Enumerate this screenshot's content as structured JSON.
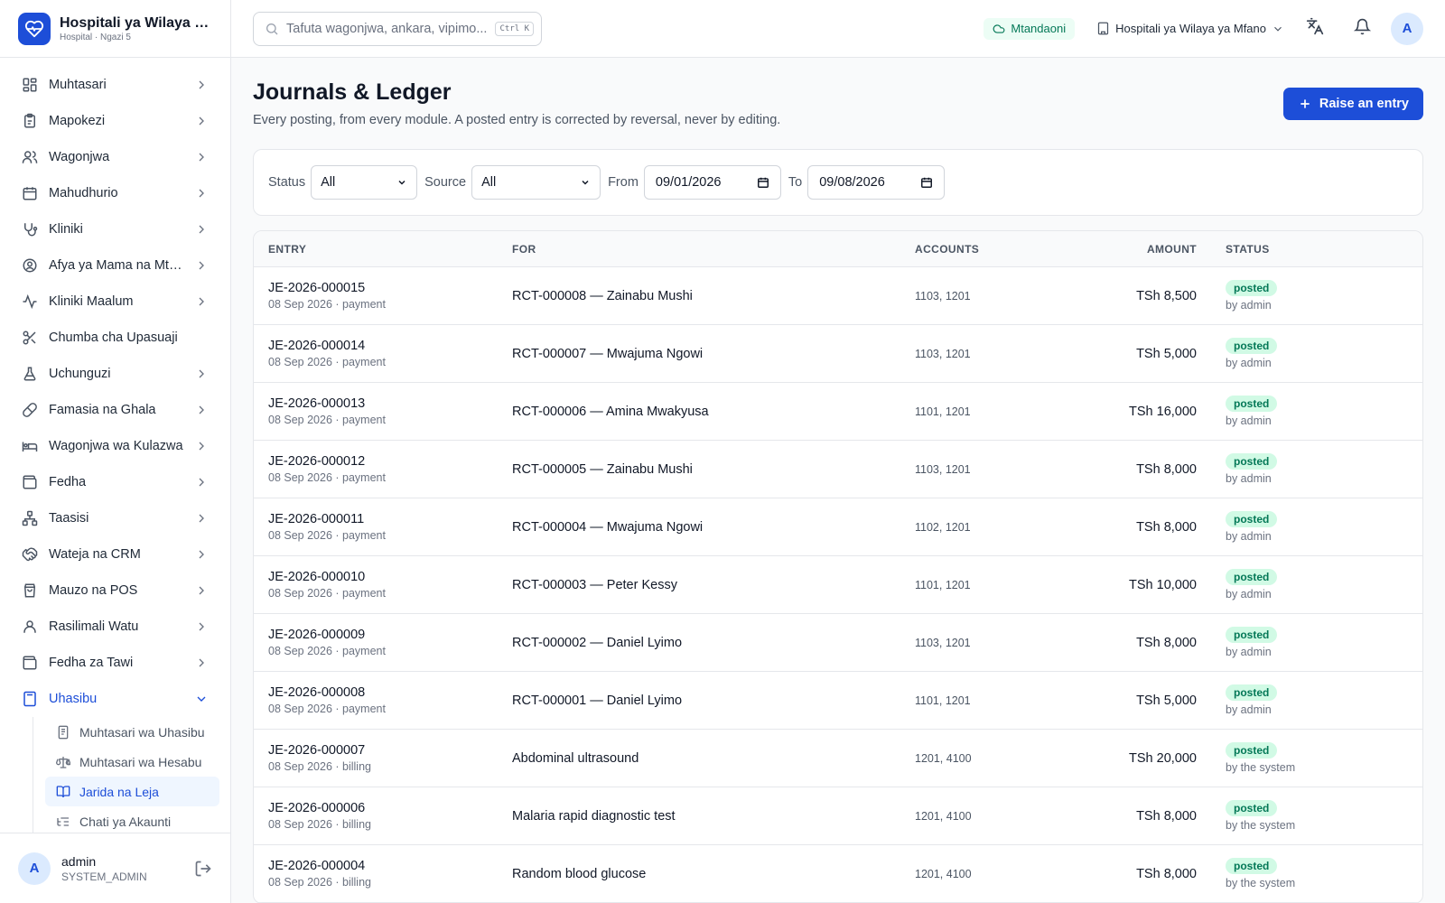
{
  "brand": {
    "title": "Hospitali ya Wilaya ya Mfano",
    "subtitle": "Hospital · Ngazi 5"
  },
  "sidebar": {
    "items": [
      {
        "label": "Muhtasari",
        "icon": "grid-icon"
      },
      {
        "label": "Mapokezi",
        "icon": "clipboard-icon"
      },
      {
        "label": "Wagonjwa",
        "icon": "users-icon"
      },
      {
        "label": "Mahudhurio",
        "icon": "calendar-icon"
      },
      {
        "label": "Kliniki",
        "icon": "stethoscope-icon"
      },
      {
        "label": "Afya ya Mama na Mtoto",
        "icon": "mother-child-icon"
      },
      {
        "label": "Kliniki Maalum",
        "icon": "activity-icon"
      },
      {
        "label": "Chumba cha Upasuaji",
        "icon": "scissors-icon"
      },
      {
        "label": "Uchunguzi",
        "icon": "flask-icon"
      },
      {
        "label": "Famasia na Ghala",
        "icon": "pill-icon"
      },
      {
        "label": "Wagonjwa wa Kulazwa",
        "icon": "bed-icon"
      },
      {
        "label": "Fedha",
        "icon": "wallet-icon"
      },
      {
        "label": "Taasisi",
        "icon": "org-icon"
      },
      {
        "label": "Wateja na CRM",
        "icon": "handshake-icon"
      },
      {
        "label": "Mauzo na POS",
        "icon": "bag-icon"
      },
      {
        "label": "Rasilimali Watu",
        "icon": "user-icon"
      },
      {
        "label": "Fedha za Tawi",
        "icon": "wallet-icon"
      },
      {
        "label": "Uhasibu",
        "icon": "calculator-icon"
      }
    ],
    "sub_items": [
      {
        "label": "Muhtasari wa Uhasibu",
        "icon": "receipt-icon"
      },
      {
        "label": "Muhtasari wa Hesabu",
        "icon": "scale-icon"
      },
      {
        "label": "Jarida na Leja",
        "icon": "book-icon"
      },
      {
        "label": "Chati ya Akaunti",
        "icon": "list-tree-icon"
      }
    ]
  },
  "user": {
    "name": "admin",
    "role": "SYSTEM_ADMIN",
    "initial": "A"
  },
  "header": {
    "search_placeholder": "Tafuta wagonjwa, ankara, vipimo...",
    "search_shortcut": "Ctrl K",
    "online_label": "Mtandaoni",
    "facility": "Hospitali ya Wilaya ya Mfano",
    "avatar_initial": "A"
  },
  "page": {
    "title": "Journals & Ledger",
    "description": "Every posting, from every module. A posted entry is corrected by reversal, never by editing.",
    "raise_button": "Raise an entry"
  },
  "filters": {
    "status_label": "Status",
    "status_value": "All",
    "source_label": "Source",
    "source_value": "All",
    "from_label": "From",
    "from_value": "09/01/2026",
    "to_label": "To",
    "to_value": "09/08/2026"
  },
  "table": {
    "headers": {
      "entry": "ENTRY",
      "for": "FOR",
      "accounts": "ACCOUNTS",
      "amount": "AMOUNT",
      "status": "STATUS"
    },
    "rows": [
      {
        "id": "JE-2026-000015",
        "meta": "08 Sep 2026 · payment",
        "for": "RCT-000008 — Zainabu Mushi",
        "accounts": "1103, 1201",
        "amount": "TSh 8,500",
        "status": "posted",
        "by": "by admin"
      },
      {
        "id": "JE-2026-000014",
        "meta": "08 Sep 2026 · payment",
        "for": "RCT-000007 — Mwajuma Ngowi",
        "accounts": "1103, 1201",
        "amount": "TSh 5,000",
        "status": "posted",
        "by": "by admin"
      },
      {
        "id": "JE-2026-000013",
        "meta": "08 Sep 2026 · payment",
        "for": "RCT-000006 — Amina Mwakyusa",
        "accounts": "1101, 1201",
        "amount": "TSh 16,000",
        "status": "posted",
        "by": "by admin"
      },
      {
        "id": "JE-2026-000012",
        "meta": "08 Sep 2026 · payment",
        "for": "RCT-000005 — Zainabu Mushi",
        "accounts": "1103, 1201",
        "amount": "TSh 8,000",
        "status": "posted",
        "by": "by admin"
      },
      {
        "id": "JE-2026-000011",
        "meta": "08 Sep 2026 · payment",
        "for": "RCT-000004 — Mwajuma Ngowi",
        "accounts": "1102, 1201",
        "amount": "TSh 8,000",
        "status": "posted",
        "by": "by admin"
      },
      {
        "id": "JE-2026-000010",
        "meta": "08 Sep 2026 · payment",
        "for": "RCT-000003 — Peter Kessy",
        "accounts": "1101, 1201",
        "amount": "TSh 10,000",
        "status": "posted",
        "by": "by admin"
      },
      {
        "id": "JE-2026-000009",
        "meta": "08 Sep 2026 · payment",
        "for": "RCT-000002 — Daniel Lyimo",
        "accounts": "1103, 1201",
        "amount": "TSh 8,000",
        "status": "posted",
        "by": "by admin"
      },
      {
        "id": "JE-2026-000008",
        "meta": "08 Sep 2026 · payment",
        "for": "RCT-000001 — Daniel Lyimo",
        "accounts": "1101, 1201",
        "amount": "TSh 5,000",
        "status": "posted",
        "by": "by admin"
      },
      {
        "id": "JE-2026-000007",
        "meta": "08 Sep 2026 · billing",
        "for": "Abdominal ultrasound",
        "accounts": "1201, 4100",
        "amount": "TSh 20,000",
        "status": "posted",
        "by": "by the system"
      },
      {
        "id": "JE-2026-000006",
        "meta": "08 Sep 2026 · billing",
        "for": "Malaria rapid diagnostic test",
        "accounts": "1201, 4100",
        "amount": "TSh 8,000",
        "status": "posted",
        "by": "by the system"
      },
      {
        "id": "JE-2026-000004",
        "meta": "08 Sep 2026 · billing",
        "for": "Random blood glucose",
        "accounts": "1201, 4100",
        "amount": "TSh 8,000",
        "status": "posted",
        "by": "by the system"
      }
    ]
  },
  "colors": {
    "primary": "#1d4ed8",
    "success_bg": "#d1fae5",
    "success_text": "#047857"
  }
}
